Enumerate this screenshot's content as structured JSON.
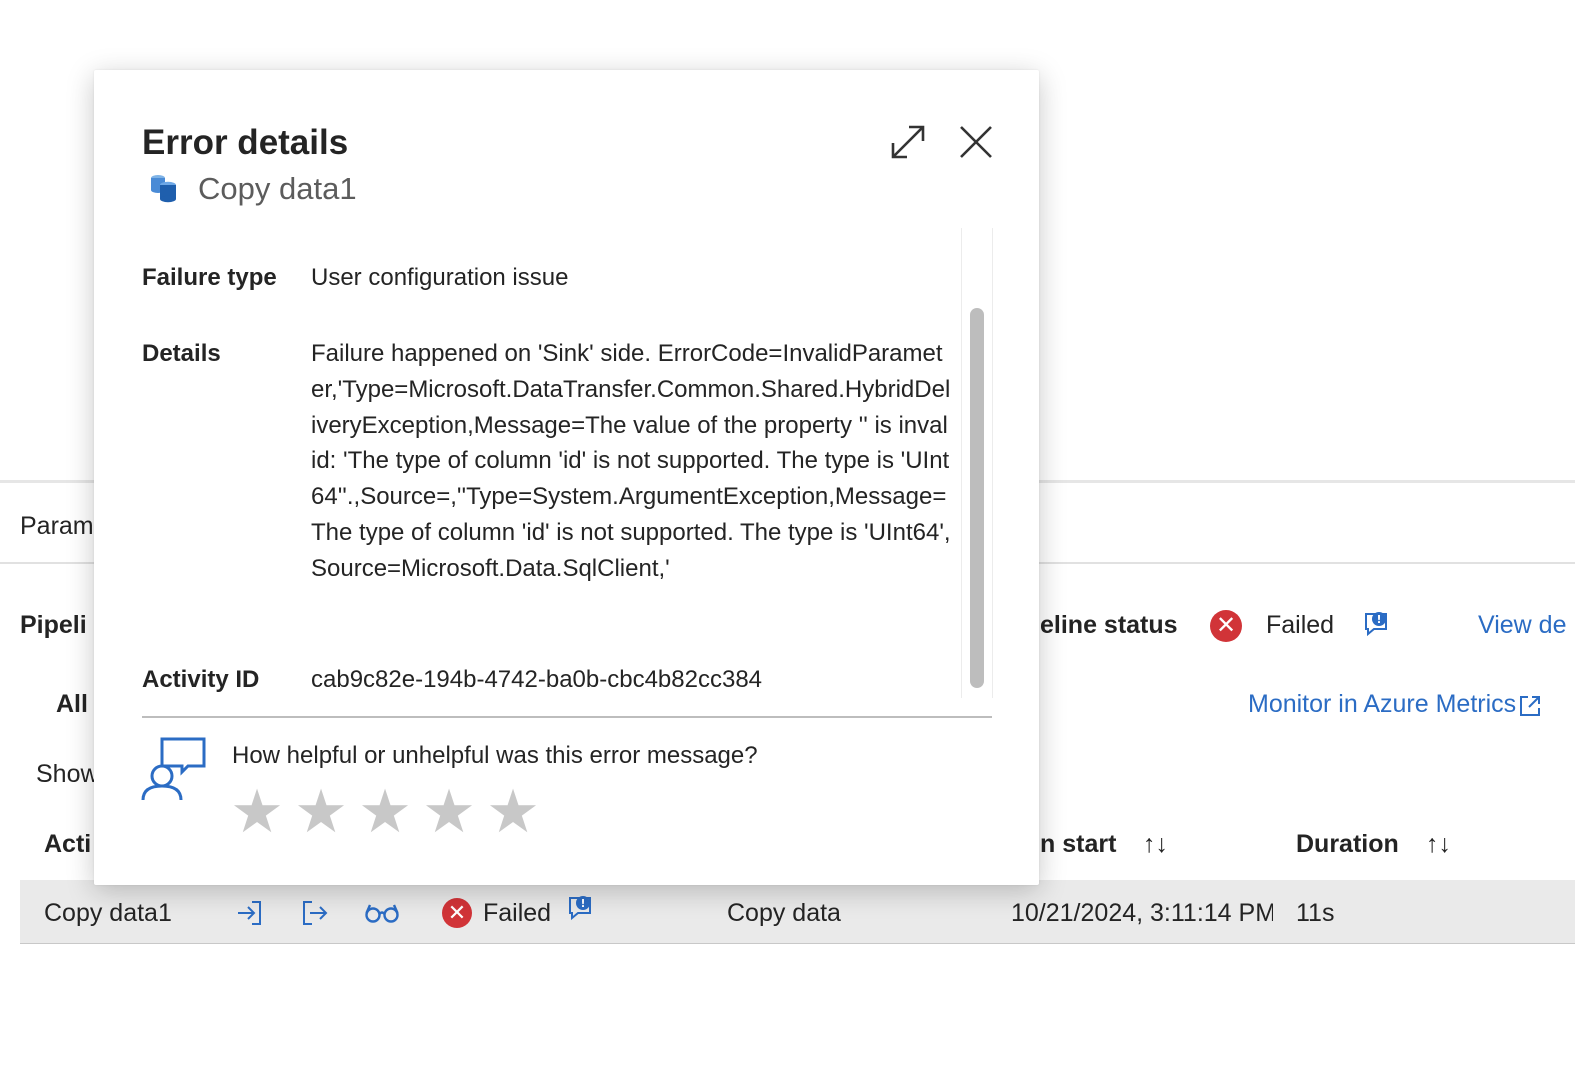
{
  "background": {
    "tab_partial": "Param",
    "section_title_partial": "Pipeli",
    "filter_all_partial": "All",
    "show_partial": "Show",
    "column_activity_partial": "Acti",
    "pipeline_status_label": "eline status",
    "pipeline_status_value": "Failed",
    "view_details_partial": "View de",
    "monitor_link": "Monitor in Azure Metrics",
    "column_run_start_partial": "n start",
    "column_duration": "Duration",
    "sort_glyph": "↑↓",
    "row": {
      "activity_name": "Copy data1",
      "status": "Failed",
      "activity_type": "Copy data",
      "run_start": "10/21/2024, 3:11:14 PM",
      "duration": "11s"
    }
  },
  "dialog": {
    "title": "Error details",
    "subtitle": "Copy data1",
    "failure_type_label": "Failure type",
    "failure_type_value": "User configuration issue",
    "details_label": "Details",
    "details_value": "Failure happened on 'Sink' side. ErrorCode=InvalidParameter,'Type=Microsoft.DataTransfer.Common.Shared.HybridDeliveryException,Message=The value of the property '' is invalid: 'The type of column 'id' is not supported. The type is 'UInt64''.,Source=,''Type=System.ArgumentException,Message=The type of column 'id' is not supported. The type is 'UInt64',Source=Microsoft.Data.SqlClient,'",
    "activity_id_label": "Activity ID",
    "activity_id_value": "cab9c82e-194b-4742-ba0b-cbc4b82cc384",
    "feedback_question": "How helpful or unhelpful was this error message?",
    "rating_stars_max": 5,
    "rating_value": 0
  },
  "colors": {
    "accent": "#2b6cc4",
    "error": "#d13438",
    "star_inactive": "#c8c8c8"
  },
  "icons": [
    "copy-data-icon",
    "expand-icon",
    "close-icon",
    "error-icon",
    "feedback-icon",
    "input-icon",
    "output-icon",
    "details-glasses-icon",
    "external-link-icon",
    "sort-icon",
    "star-icon"
  ]
}
